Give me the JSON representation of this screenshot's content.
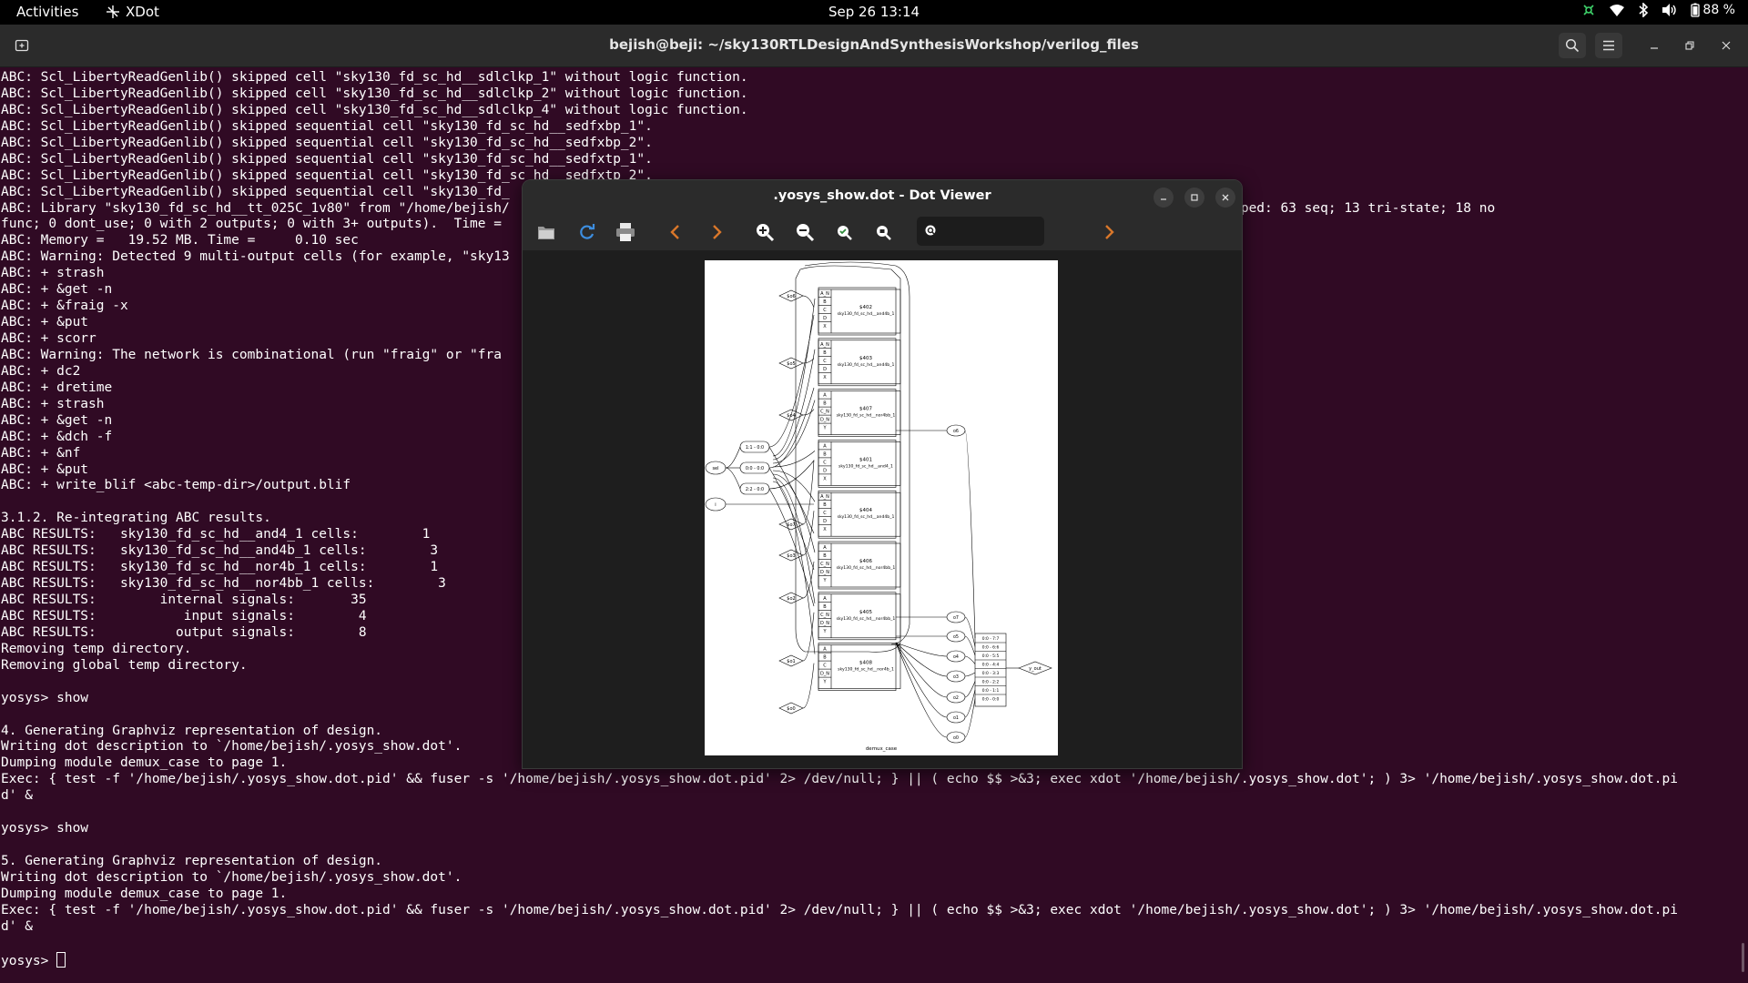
{
  "topbar": {
    "activities": "Activities",
    "app": "XDot",
    "clock": "Sep 26  13:14",
    "battery": "88 %"
  },
  "terminal": {
    "title": "bejish@beji: ~/sky130RTLDesignAndSynthesisWorkshop/verilog_files",
    "lines": [
      "ABC: Scl_LibertyReadGenlib() skipped cell \"sky130_fd_sc_hd__sdlclkp_1\" without logic function.",
      "ABC: Scl_LibertyReadGenlib() skipped cell \"sky130_fd_sc_hd__sdlclkp_2\" without logic function.",
      "ABC: Scl_LibertyReadGenlib() skipped cell \"sky130_fd_sc_hd__sdlclkp_4\" without logic function.",
      "ABC: Scl_LibertyReadGenlib() skipped sequential cell \"sky130_fd_sc_hd__sedfxbp_1\".",
      "ABC: Scl_LibertyReadGenlib() skipped sequential cell \"sky130_fd_sc_hd__sedfxbp_2\".",
      "ABC: Scl_LibertyReadGenlib() skipped sequential cell \"sky130_fd_sc_hd__sedfxtp_1\".",
      "ABC: Scl_LibertyReadGenlib() skipped sequential cell \"sky130_fd_sc_hd__sedfxtp_2\".",
      "ABC: Scl_LibertyReadGenlib() skipped sequential cell \"sky130_fd_                                                   ",
      "ABC: Library \"sky130_fd_sc_hd__tt_025C_1v80\" from \"/home/bejish/                                                                 lib\" has 324 cells (94 skipped: 63 seq; 13 tri-state; 18 no",
      "func; 0 dont_use; 0 with 2 outputs; 0 with 3+ outputs).  Time =",
      "ABC: Memory =   19.52 MB. Time =     0.10 sec",
      "ABC: Warning: Detected 9 multi-output cells (for example, \"sky13",
      "ABC: + strash",
      "ABC: + &get -n",
      "ABC: + &fraig -x",
      "ABC: + &put",
      "ABC: + scorr",
      "ABC: Warning: The network is combinational (run \"fraig\" or \"fra",
      "ABC: + dc2",
      "ABC: + dretime",
      "ABC: + strash",
      "ABC: + &get -n",
      "ABC: + &dch -f",
      "ABC: + &nf",
      "ABC: + &put",
      "ABC: + write_blif <abc-temp-dir>/output.blif",
      "",
      "3.1.2. Re-integrating ABC results.",
      "ABC RESULTS:   sky130_fd_sc_hd__and4_1 cells:        1",
      "ABC RESULTS:   sky130_fd_sc_hd__and4b_1 cells:        3",
      "ABC RESULTS:   sky130_fd_sc_hd__nor4b_1 cells:        1",
      "ABC RESULTS:   sky130_fd_sc_hd__nor4bb_1 cells:        3",
      "ABC RESULTS:        internal signals:       35",
      "ABC RESULTS:           input signals:        4",
      "ABC RESULTS:          output signals:        8",
      "Removing temp directory.",
      "Removing global temp directory.",
      "",
      "yosys> show",
      "",
      "4. Generating Graphviz representation of design.",
      "Writing dot description to `/home/bejish/.yosys_show.dot'.",
      "Dumping module demux_case to page 1.",
      "Exec: { test -f '/home/bejish/.yosys_show.dot.pid' && fuser -s '/home/bejish/.yosys_show.dot.pid' 2> /dev/null; } || ( echo $$ >&3; exec xdot '/home/bejish/.yosys_show.dot'; ) 3> '/home/bejish/.yosys_show.dot.pi",
      "d' &",
      "",
      "yosys> show",
      "",
      "5. Generating Graphviz representation of design.",
      "Writing dot description to `/home/bejish/.yosys_show.dot'.",
      "Dumping module demux_case to page 1.",
      "Exec: { test -f '/home/bejish/.yosys_show.dot.pid' && fuser -s '/home/bejish/.yosys_show.dot.pid' 2> /dev/null; } || ( echo $$ >&3; exec xdot '/home/bejish/.yosys_show.dot'; ) 3> '/home/bejish/.yosys_show.dot.pi",
      "d' &",
      ""
    ],
    "prompt": "yosys> "
  },
  "viewer": {
    "title": ".yosys_show.dot - Dot Viewer",
    "search_value": "",
    "graph": {
      "module_label": "demux_case",
      "inputs": [
        "sel",
        "i"
      ],
      "selectors": [
        "1:1 - 0:0",
        "0:0 - 0:0",
        "2:2 - 0:0"
      ],
      "outputs": [
        "$o6",
        "$o5",
        "$o4",
        "$o7",
        "$o3",
        "$o2",
        "$o1",
        "$o0"
      ],
      "out_net": "y_out",
      "right_nets": [
        "o6",
        "o7",
        "o5",
        "o4",
        "o3",
        "o2",
        "o1",
        "o0"
      ],
      "concat_ports": [
        "0:0 - 7:7",
        "0:0 - 6:6",
        "0:0 - 5:5",
        "0:0 - 4:4",
        "0:0 - 3:3",
        "0:0 - 2:2",
        "0:0 - 1:1",
        "0:0 - 0:0"
      ],
      "cells": [
        {
          "id": "$402",
          "type": "sky130_fd_sc_hd__and4b_1",
          "ports": [
            "A_N",
            "B",
            "C",
            "D",
            "X"
          ]
        },
        {
          "id": "$403",
          "type": "sky130_fd_sc_hd__and4b_1",
          "ports": [
            "A_N",
            "B",
            "C",
            "D",
            "X"
          ]
        },
        {
          "id": "$407",
          "type": "sky130_fd_sc_hd__nor4bb_1",
          "ports": [
            "A",
            "B",
            "C_N",
            "D_N",
            "Y"
          ]
        },
        {
          "id": "$401",
          "type": "sky130_fd_sc_hd__and4_1",
          "ports": [
            "A",
            "B",
            "C",
            "D",
            "X"
          ]
        },
        {
          "id": "$404",
          "type": "sky130_fd_sc_hd__and4b_1",
          "ports": [
            "A_N",
            "B",
            "C",
            "D",
            "X"
          ]
        },
        {
          "id": "$406",
          "type": "sky130_fd_sc_hd__nor4bb_1",
          "ports": [
            "A",
            "B",
            "C_N",
            "D_N",
            "Y"
          ]
        },
        {
          "id": "$405",
          "type": "sky130_fd_sc_hd__nor4bb_1",
          "ports": [
            "A",
            "B",
            "C_N",
            "D_N",
            "Y"
          ]
        },
        {
          "id": "$408",
          "type": "sky130_fd_sc_hd__nor4b_1",
          "ports": [
            "A",
            "B",
            "C",
            "D_N",
            "Y"
          ]
        }
      ]
    }
  }
}
